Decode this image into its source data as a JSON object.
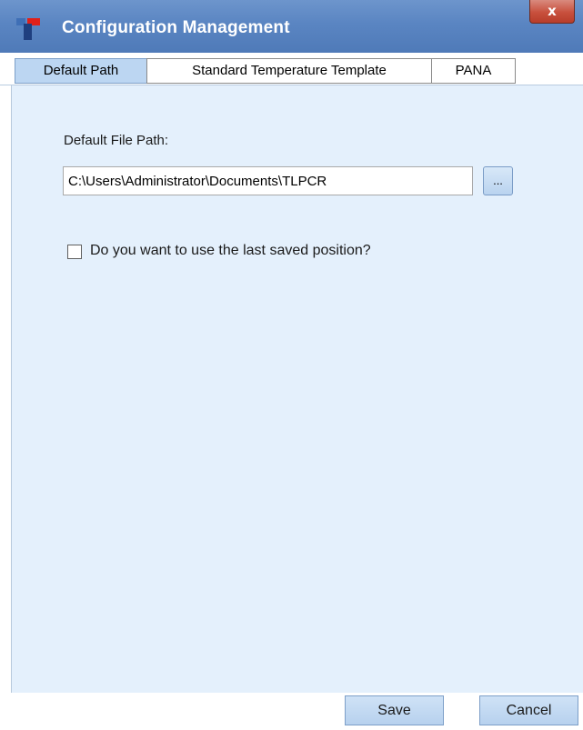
{
  "window": {
    "title": "Configuration Management",
    "close_label": "x",
    "icon": "app-logo-icon"
  },
  "tabs": [
    {
      "label": "Default Path",
      "active": true
    },
    {
      "label": "Standard Temperature Template",
      "active": false
    },
    {
      "label": "PANA",
      "active": false
    }
  ],
  "default_path": {
    "label": "Default File Path:",
    "value": "C:\\Users\\Administrator\\Documents\\TLPCR",
    "browse_label": "...",
    "checkbox_label": "Do you want to use the last saved position?",
    "checkbox_checked": false
  },
  "footer": {
    "save_label": "Save",
    "cancel_label": "Cancel"
  },
  "colors": {
    "titlebar": "#5a85c2",
    "panel_bg": "#e4f0fc",
    "active_tab": "#bcd6f2",
    "close_button": "#c8503d"
  }
}
